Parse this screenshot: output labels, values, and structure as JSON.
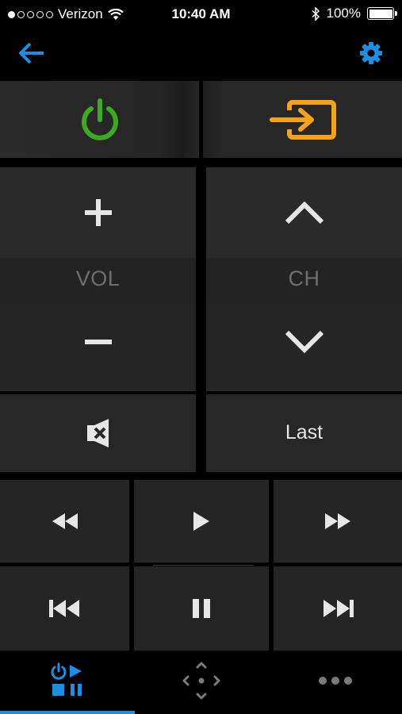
{
  "status_bar": {
    "carrier": "Verizon",
    "time": "10:40 AM",
    "battery": "100%"
  },
  "colors": {
    "accent": "#1a8fe3",
    "power": "#3dab1f",
    "input": "#f7a21b"
  },
  "volume": {
    "label": "VOL"
  },
  "channel": {
    "label": "CH"
  },
  "last_label": "Last",
  "tabs": [
    {
      "icon": "playback-controls-icon",
      "active": true
    },
    {
      "icon": "dpad-icon",
      "active": false
    },
    {
      "icon": "more-icon",
      "active": false
    }
  ]
}
